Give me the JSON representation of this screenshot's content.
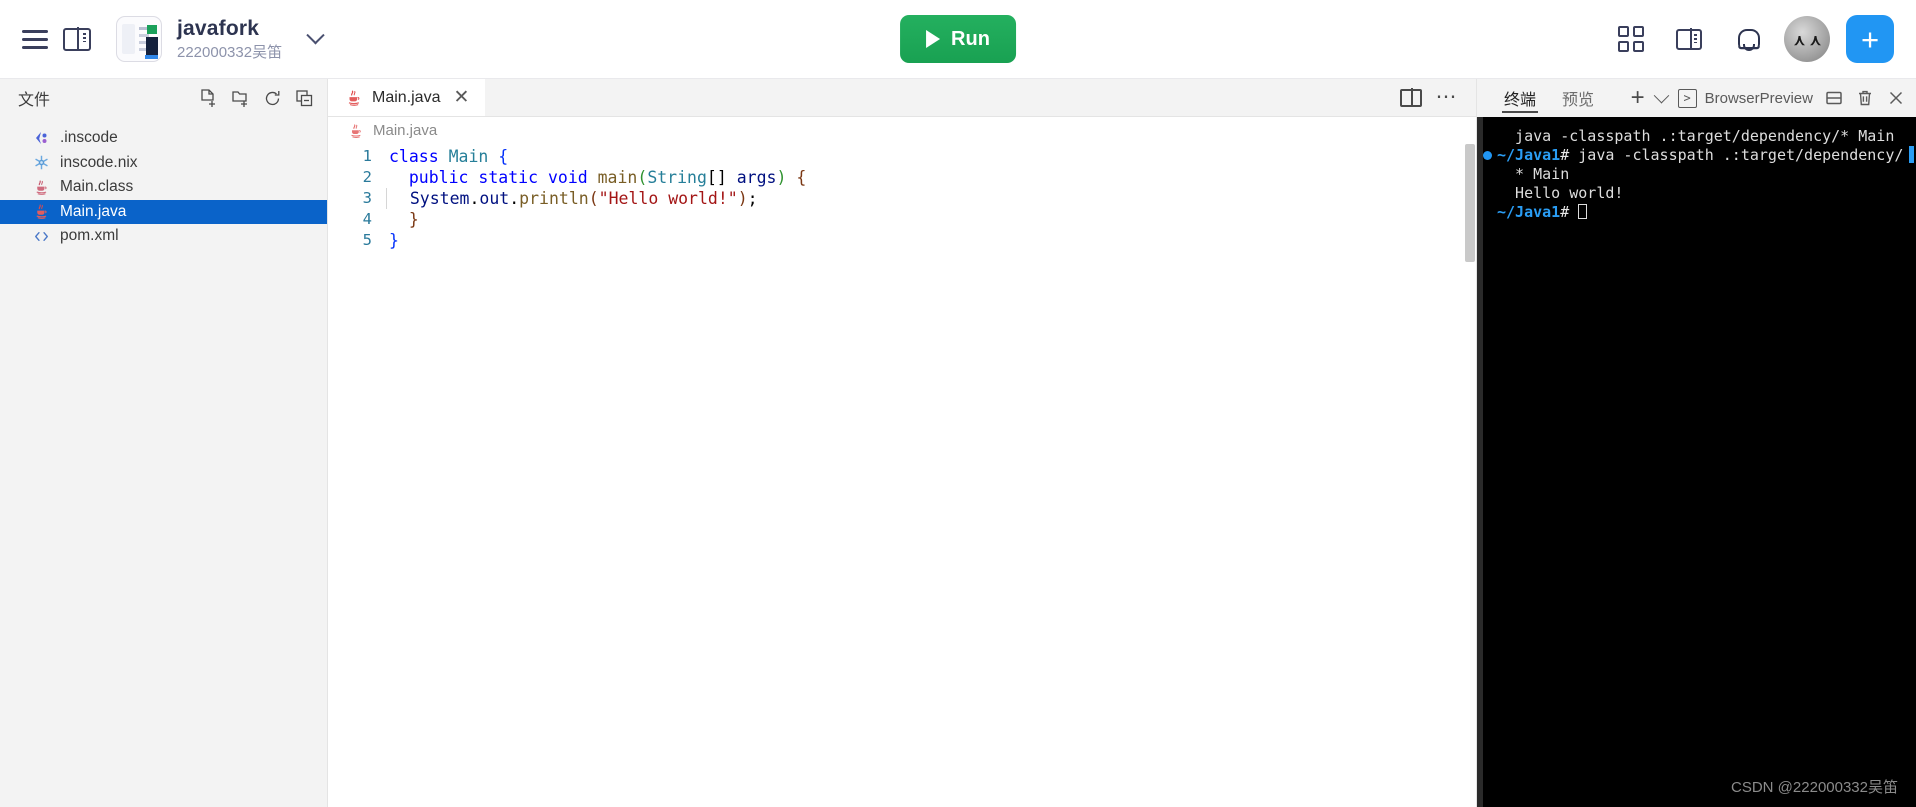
{
  "topbar": {
    "menu_icon": "hamburger-icon",
    "sidebar_toggle_icon": "panel-left-icon",
    "project_name": "javafork",
    "project_owner": "222000332吴笛",
    "dropdown_icon": "chevron-down-icon",
    "run_label": "Run",
    "run_icon": "play-icon",
    "apps_icon": "grid-apps-icon",
    "layout_icon": "panel-layout-icon",
    "bell_icon": "bell-icon",
    "avatar_icon": "user-avatar",
    "add_icon": "plus-icon",
    "accent_green": "#19a152",
    "accent_blue": "#2196f3"
  },
  "sidebar": {
    "title": "文件",
    "actions": [
      {
        "name": "new-file-icon",
        "tooltip": "新建文件"
      },
      {
        "name": "new-folder-icon",
        "tooltip": "新建文件夹"
      },
      {
        "name": "refresh-icon",
        "tooltip": "刷新"
      },
      {
        "name": "collapse-all-icon",
        "tooltip": "折叠"
      }
    ],
    "files": [
      {
        "label": ".inscode",
        "icon": "inscode-icon",
        "selected": false
      },
      {
        "label": "inscode.nix",
        "icon": "nix-snowflake-icon",
        "selected": false
      },
      {
        "label": "Main.class",
        "icon": "java-icon",
        "selected": false
      },
      {
        "label": "Main.java",
        "icon": "java-icon",
        "selected": true
      },
      {
        "label": "pom.xml",
        "icon": "xml-icon",
        "selected": false
      }
    ],
    "selection_color": "#0a63c9"
  },
  "editor": {
    "tabs": [
      {
        "label": "Main.java",
        "icon": "java-icon",
        "active": true,
        "close_icon": "close-icon"
      }
    ],
    "split_icon": "split-editor-icon",
    "more_icon": "more-actions-icon",
    "breadcrumb": "Main.java",
    "breadcrumb_icon": "java-icon",
    "lines": [
      {
        "num": "1",
        "indent": 0,
        "tokens": [
          {
            "t": "class ",
            "c": "k-kw"
          },
          {
            "t": "Main ",
            "c": "k-cls"
          },
          {
            "t": "{",
            "c": "k-punct1"
          }
        ]
      },
      {
        "num": "2",
        "indent": 0,
        "tokens": [
          {
            "t": "  ",
            "c": "k-p"
          },
          {
            "t": "public static void ",
            "c": "k-kw"
          },
          {
            "t": "main",
            "c": "k-fn"
          },
          {
            "t": "(",
            "c": "k-punct2"
          },
          {
            "t": "String",
            "c": "k-type"
          },
          {
            "t": "[] ",
            "c": "k-p"
          },
          {
            "t": "args",
            "c": "k-var"
          },
          {
            "t": ")",
            "c": "k-punct2"
          },
          {
            "t": " {",
            "c": "k-punct3"
          }
        ]
      },
      {
        "num": "3",
        "indent": 1,
        "tokens": [
          {
            "t": "  ",
            "c": "k-p"
          },
          {
            "t": "System",
            "c": "k-var"
          },
          {
            "t": ".",
            "c": "k-p"
          },
          {
            "t": "out",
            "c": "k-var"
          },
          {
            "t": ".",
            "c": "k-p"
          },
          {
            "t": "println",
            "c": "k-fn"
          },
          {
            "t": "(",
            "c": "k-punct3"
          },
          {
            "t": "\"Hello world!\"",
            "c": "k-str"
          },
          {
            "t": ")",
            "c": "k-punct3"
          },
          {
            "t": ";",
            "c": "k-p"
          }
        ]
      },
      {
        "num": "4",
        "indent": 0,
        "tokens": [
          {
            "t": "  }",
            "c": "k-punct3"
          }
        ]
      },
      {
        "num": "5",
        "indent": 0,
        "tokens": [
          {
            "t": "}",
            "c": "k-punct1"
          }
        ]
      }
    ]
  },
  "rightpanel": {
    "tabs": [
      {
        "label": "终端",
        "active": true
      },
      {
        "label": "预览",
        "active": false
      }
    ],
    "add_icon": "plus-icon",
    "add_chevron_icon": "chevron-down-icon",
    "browser_preview_label": "BrowserPreview",
    "browser_preview_icon": "terminal-chevron-icon",
    "split_icon": "split-horizontal-icon",
    "trash_icon": "trash-icon",
    "close_icon": "close-icon",
    "terminal": {
      "lines": [
        {
          "type": "plain",
          "text": "  java -classpath .:target/dependency/* Main"
        },
        {
          "type": "prompt",
          "dot": true,
          "prompt": "~/Java1",
          "hash": "# ",
          "text": "java -classpath .:target/dependency/"
        },
        {
          "type": "plain",
          "text": "  * Main"
        },
        {
          "type": "plain",
          "text": "  Hello world!"
        },
        {
          "type": "prompt",
          "dot": false,
          "prompt": "~/Java1",
          "hash": "# ",
          "text": "",
          "cursor": true
        }
      ]
    }
  },
  "watermark": "CSDN @222000332吴笛"
}
